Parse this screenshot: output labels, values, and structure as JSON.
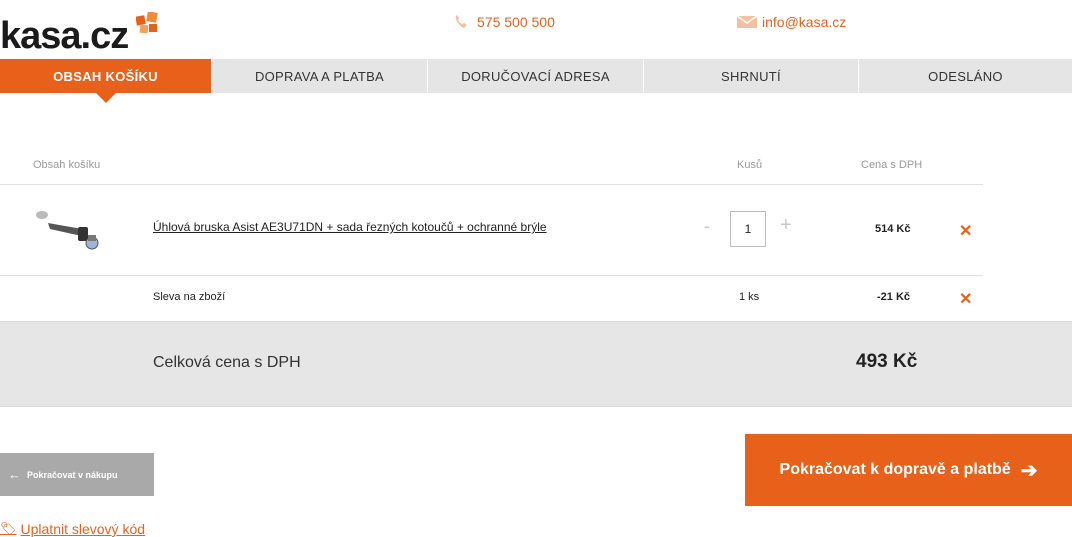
{
  "header": {
    "logo": "kasa.cz",
    "phone": "575 500 500",
    "email": "info@kasa.cz",
    "colors": {
      "accent": "#e8611a"
    }
  },
  "steps": [
    {
      "label": "OBSAH KOŠÍKU",
      "active": true
    },
    {
      "label": "DOPRAVA A PLATBA",
      "active": false
    },
    {
      "label": "DORUČOVACÍ ADRESA",
      "active": false
    },
    {
      "label": "SHRNUTÍ",
      "active": false
    },
    {
      "label": "ODESLÁNO",
      "active": false
    }
  ],
  "table": {
    "headers": {
      "content": "Obsah košíku",
      "qty": "Kusů",
      "price": "Cena s DPH"
    },
    "item": {
      "name": "Úhlová bruska Asist AE3U71DN + sada řezných kotoučů + ochranné brýle",
      "qty": "1",
      "price": "514 Kč",
      "minus": "-",
      "plus": "+",
      "remove": "✕"
    },
    "discount": {
      "label": "Sleva na zboží",
      "qty": "1 ks",
      "price": "-21 Kč",
      "remove": "✕"
    }
  },
  "total": {
    "label": "Celková cena s DPH",
    "value": "493 Kč"
  },
  "buttons": {
    "back": "Pokračovat v nákupu",
    "next": "Pokračovat k dopravě a platbě"
  },
  "coupon": "Uplatnit slevový kód"
}
